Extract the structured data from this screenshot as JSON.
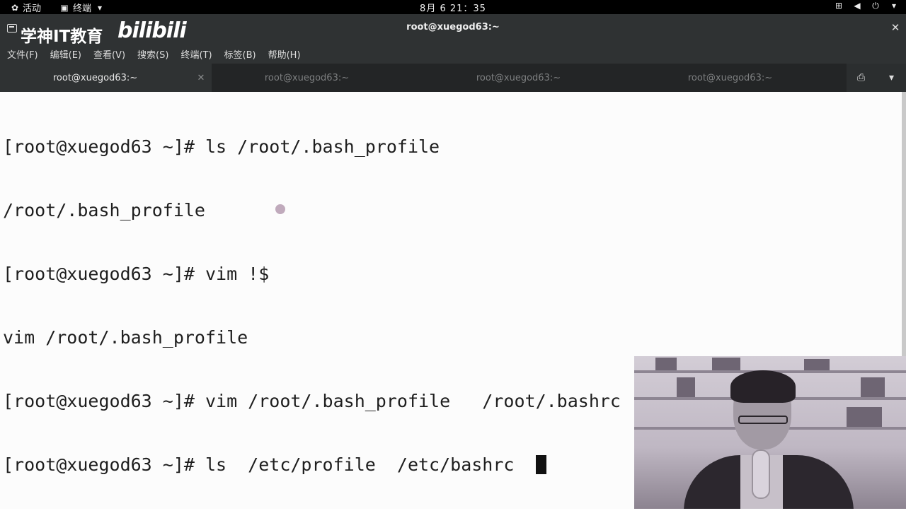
{
  "topbar": {
    "activities_label": "活动",
    "app_menu_label": "终端",
    "clock": "8月 6  21：35",
    "tray_icons": [
      "network-icon",
      "volume-icon",
      "power-icon"
    ]
  },
  "window": {
    "title": "root@xuegod63:~",
    "watermark_cn": "学神IT教育",
    "watermark_bili": "bilibili"
  },
  "menu": {
    "items": [
      "文件(F)",
      "编辑(E)",
      "查看(V)",
      "搜索(S)",
      "终端(T)",
      "标签(B)",
      "帮助(H)"
    ]
  },
  "tabs": [
    {
      "label": "root@xuegod63:~",
      "active": true
    },
    {
      "label": "root@xuegod63:~",
      "active": false
    },
    {
      "label": "root@xuegod63:~",
      "active": false
    },
    {
      "label": "root@xuegod63:~",
      "active": false
    }
  ],
  "terminal": {
    "lines": [
      "[root@xuegod63 ~]# ls /root/.bash_profile",
      "/root/.bash_profile",
      "[root@xuegod63 ~]# vim !$",
      "vim /root/.bash_profile",
      "[root@xuegod63 ~]# vim /root/.bash_profile   /root/.bashrc  ^C",
      "[root@xuegod63 ~]# ls  /etc/profile  /etc/bashrc  "
    ]
  },
  "colors": {
    "terminal_bg": "#fcfcfc",
    "terminal_fg": "#1e1e1e",
    "chrome_bg": "#2f3233",
    "topbar_bg": "#000000"
  }
}
